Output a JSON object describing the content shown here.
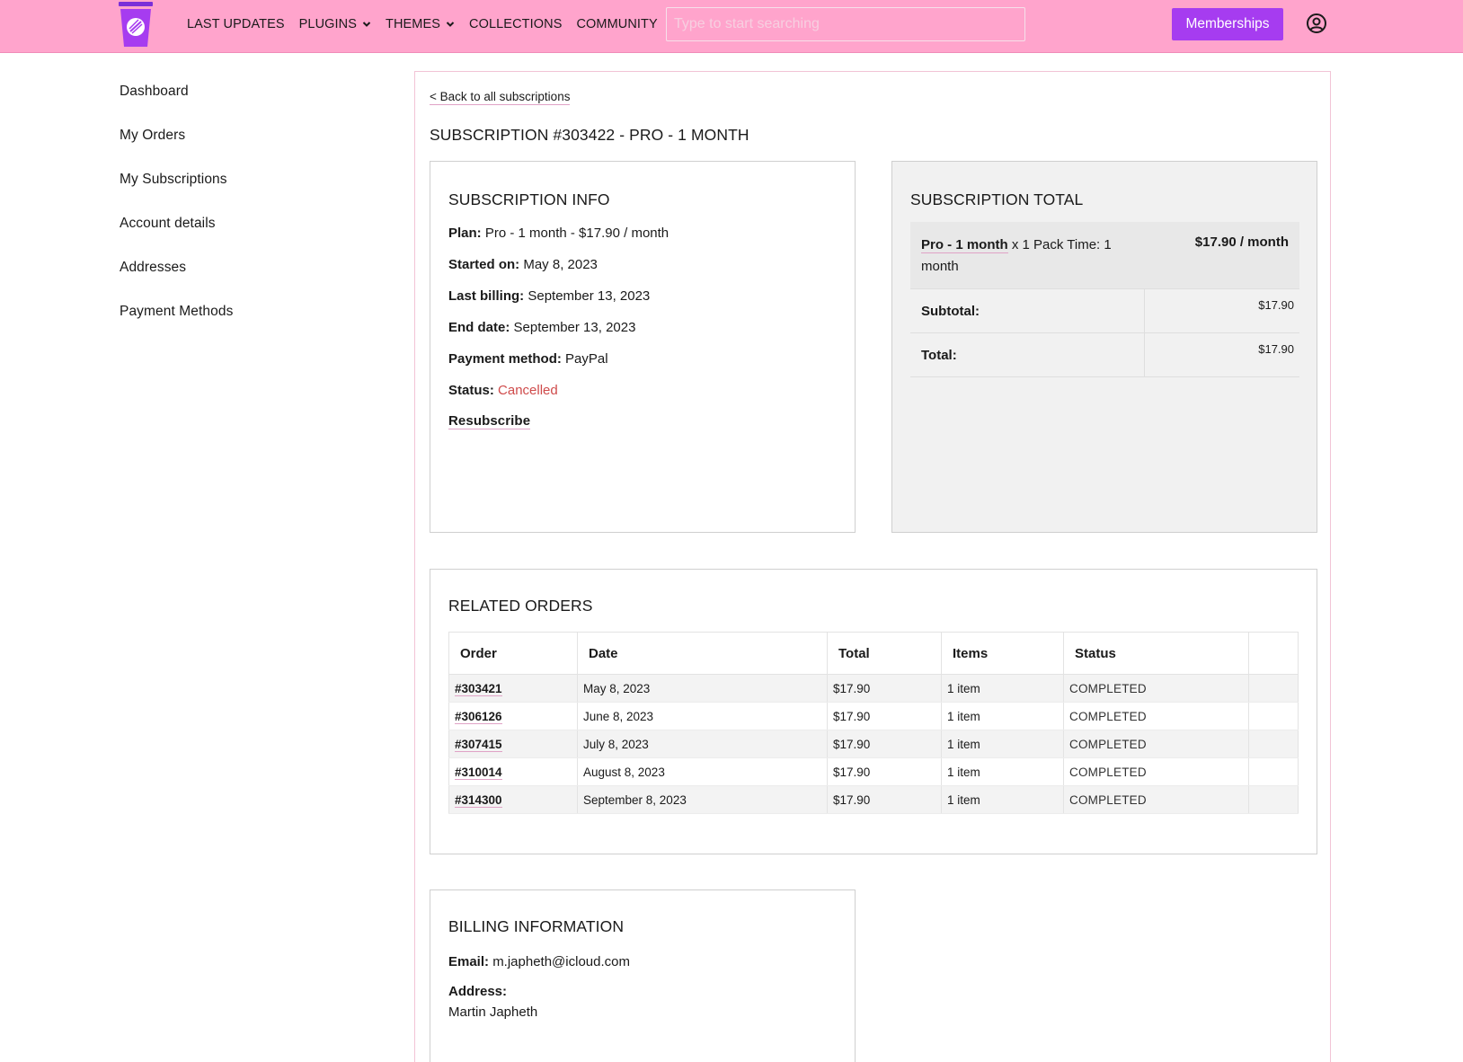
{
  "header": {
    "nav": [
      {
        "label": "LAST UPDATES",
        "dropdown": false
      },
      {
        "label": "PLUGINS",
        "dropdown": true
      },
      {
        "label": "THEMES",
        "dropdown": true
      },
      {
        "label": "COLLECTIONS",
        "dropdown": false
      },
      {
        "label": "COMMUNITY",
        "dropdown": false
      }
    ],
    "search_placeholder": "Type to start searching",
    "memberships_label": "Memberships"
  },
  "sidebar": {
    "items": [
      {
        "label": "Dashboard"
      },
      {
        "label": "My Orders"
      },
      {
        "label": "My Subscriptions"
      },
      {
        "label": "Account details"
      },
      {
        "label": "Addresses"
      },
      {
        "label": "Payment Methods"
      }
    ]
  },
  "main": {
    "back_label": "< Back to all subscriptions",
    "title": "SUBSCRIPTION #303422 - PRO - 1 MONTH"
  },
  "info": {
    "title": "SUBSCRIPTION INFO",
    "rows": [
      {
        "label": "Plan:",
        "value": "Pro - 1 month - $17.90 / month"
      },
      {
        "label": "Started on:",
        "value": "May 8, 2023"
      },
      {
        "label": "Last billing:",
        "value": "September 13, 2023"
      },
      {
        "label": "End date:",
        "value": "September 13, 2023"
      },
      {
        "label": "Payment method:",
        "value": "PayPal"
      }
    ],
    "status_label": "Status:",
    "status_value": "Cancelled",
    "resubscribe_label": "Resubscribe"
  },
  "totals": {
    "title": "SUBSCRIPTION TOTAL",
    "product_name": "Pro - 1 month",
    "product_suffix": "x 1 Pack Time: 1 month",
    "product_price": "$17.90 / month",
    "subtotal_label": "Subtotal:",
    "subtotal_value": "$17.90",
    "total_label": "Total:",
    "total_value": "$17.90"
  },
  "orders": {
    "title": "RELATED ORDERS",
    "columns": [
      "Order",
      "Date",
      "Total",
      "Items",
      "Status",
      ""
    ],
    "rows": [
      {
        "order": "#303421",
        "date": "May 8, 2023",
        "total": "$17.90",
        "items": "1 item",
        "status": "COMPLETED"
      },
      {
        "order": "#306126",
        "date": "June 8, 2023",
        "total": "$17.90",
        "items": "1 item",
        "status": "COMPLETED"
      },
      {
        "order": "#307415",
        "date": "July 8, 2023",
        "total": "$17.90",
        "items": "1 item",
        "status": "COMPLETED"
      },
      {
        "order": "#310014",
        "date": "August 8, 2023",
        "total": "$17.90",
        "items": "1 item",
        "status": "COMPLETED"
      },
      {
        "order": "#314300",
        "date": "September 8, 2023",
        "total": "$17.90",
        "items": "1 item",
        "status": "COMPLETED"
      }
    ]
  },
  "billing": {
    "title": "BILLING INFORMATION",
    "email_label": "Email:",
    "email_value": "m.japheth@icloud.com",
    "address_label": "Address:",
    "address_name": "Martin Japheth"
  },
  "colors": {
    "header_bg": "#ffa4cc",
    "accent": "#a63cf0",
    "status_cancelled": "#cf4b4b",
    "link_underline": "#e0a2c6"
  },
  "icons": {
    "logo": "cup-logo-icon",
    "user": "user-circle-icon",
    "chevron": "chevron-down-icon"
  }
}
